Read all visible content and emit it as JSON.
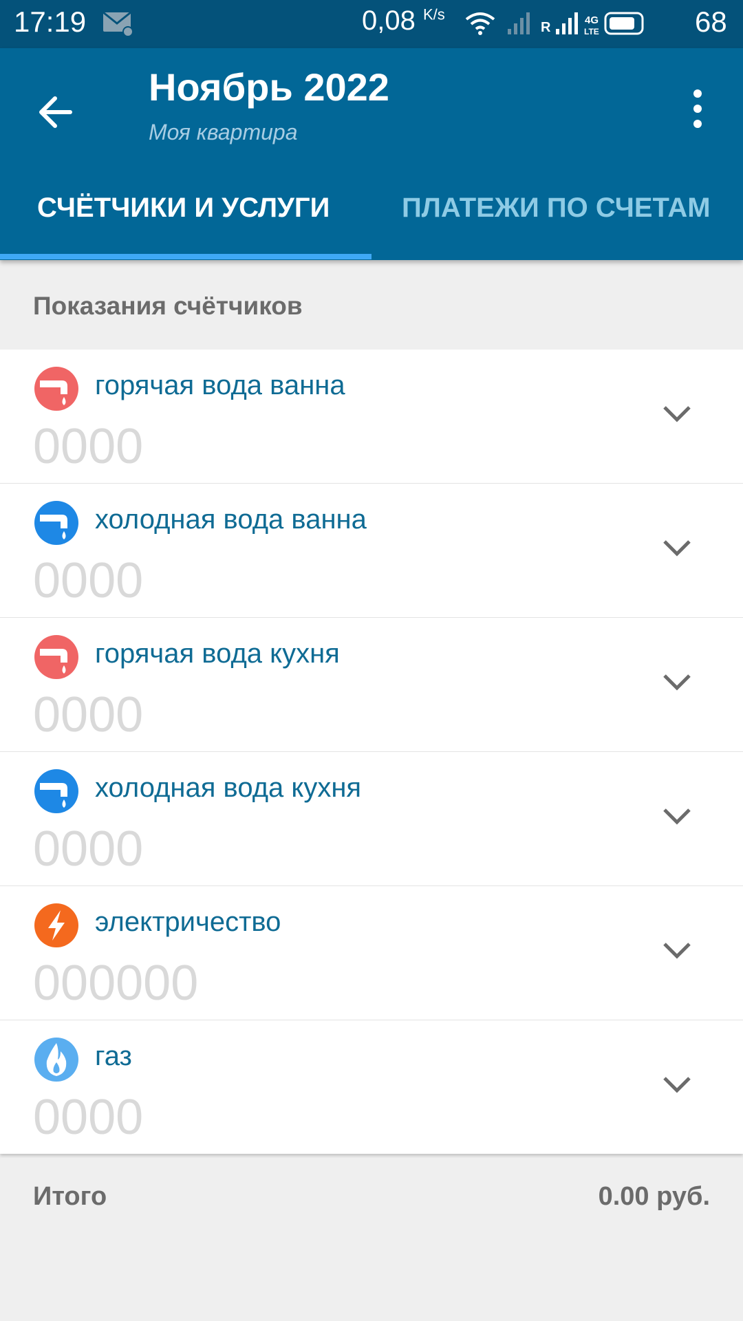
{
  "statusbar": {
    "time": "17:19",
    "speed": "0,08",
    "speed_unit": "K/s",
    "battery": "68",
    "roaming": "R",
    "network": "4G",
    "network_sub": "LTE"
  },
  "header": {
    "title": "Ноябрь 2022",
    "subtitle": "Моя квартира"
  },
  "tabs": [
    {
      "label": "СЧЁТЧИКИ И УСЛУГИ",
      "active": true
    },
    {
      "label": "ПЛАТЕЖИ ПО СЧЕТАМ",
      "active": false
    }
  ],
  "section": {
    "title": "Показания счётчиков"
  },
  "meters": [
    {
      "label": "горячая вода ванна",
      "placeholder": "0000",
      "icon": "hot-water-tap-icon",
      "color": "#f06565"
    },
    {
      "label": "холодная вода ванна",
      "placeholder": "0000",
      "icon": "cold-water-tap-icon",
      "color": "#1e88e5"
    },
    {
      "label": "горячая вода кухня",
      "placeholder": "0000",
      "icon": "hot-water-tap-icon",
      "color": "#f06565"
    },
    {
      "label": "холодная вода кухня",
      "placeholder": "0000",
      "icon": "cold-water-tap-icon",
      "color": "#1e88e5"
    },
    {
      "label": "электричество",
      "placeholder": "000000",
      "icon": "lightning-icon",
      "color": "#f4691e"
    },
    {
      "label": "газ",
      "placeholder": "0000",
      "icon": "flame-icon",
      "color": "#5aaef0"
    }
  ],
  "footer": {
    "total_label": "Итого",
    "total_value": "0.00 руб."
  },
  "colors": {
    "appbar": "#026797",
    "statusbar": "#04527a",
    "tab_indicator": "#3fa9f5",
    "label_text": "#0f6b94"
  }
}
